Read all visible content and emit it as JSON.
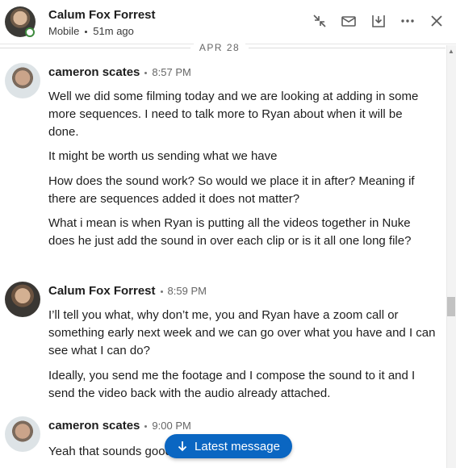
{
  "header": {
    "name": "Calum Fox Forrest",
    "device": "Mobile",
    "last_seen": "51m ago",
    "icons": [
      "collapse-icon",
      "message-icon",
      "download-icon",
      "more-icon",
      "close-icon"
    ]
  },
  "date_separator": "APR 28",
  "messages": [
    {
      "sender": "cameron scates",
      "time": "8:57 PM",
      "paragraphs": [
        "Well we did some filming today and we are looking at adding in some more sequences. I need to talk more to Ryan about when it will be done.",
        "It might be worth us sending what we have",
        "How does the sound work? So would we place it in after? Meaning if there are sequences added it does not matter?",
        "What i mean is when Ryan is putting all the videos together in Nuke does he just add the sound in over each clip or is it all one long file?"
      ]
    },
    {
      "sender": "Calum Fox Forrest",
      "time": "8:59 PM",
      "paragraphs": [
        "I’ll tell you what, why don’t me, you and Ryan have a zoom call or something early next week and we can go over what you have and I can see what I can do?",
        "Ideally, you send me the footage and I compose the sound to it and I send the video back with the audio already attached."
      ]
    },
    {
      "sender": "cameron scates",
      "time": "9:00 PM",
      "paragraphs": [
        "Yeah that sounds good"
      ]
    }
  ],
  "latest_button": "Latest message",
  "colors": {
    "accent": "#0a66c2",
    "presence": "#3e8a3e"
  }
}
